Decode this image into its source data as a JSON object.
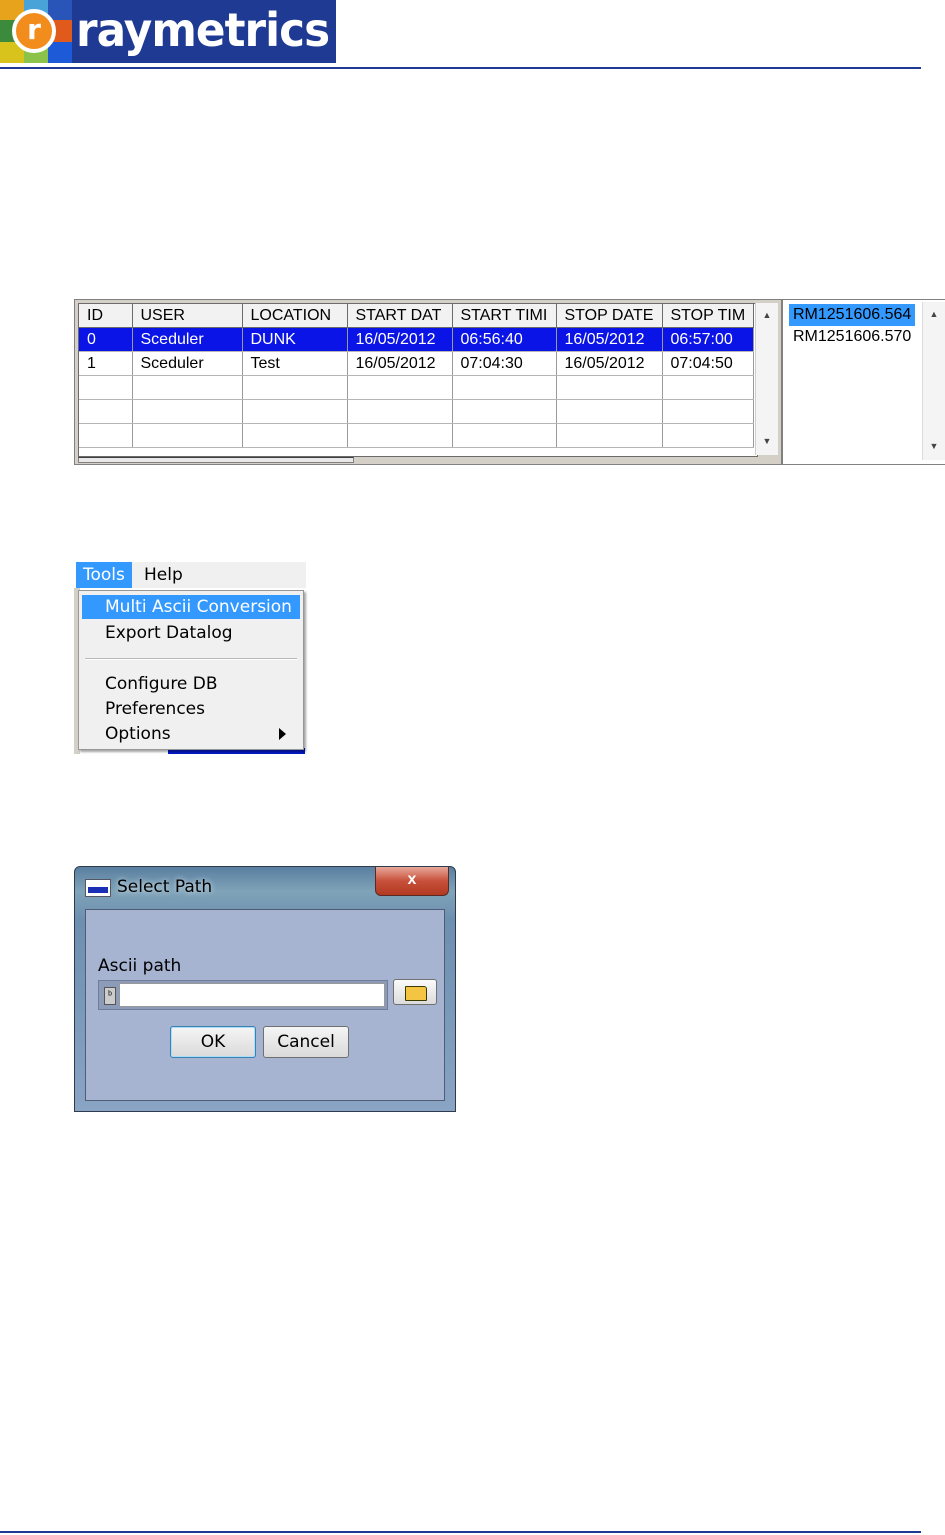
{
  "header": {
    "logo_text": "raymetrics",
    "logo_mark": "r",
    "brand_color": "#1f3a93"
  },
  "datalog_grid": {
    "columns": [
      "ID",
      "USER",
      "LOCATION",
      "START DAT",
      "START TIMI",
      "STOP DATE",
      "STOP TIM"
    ],
    "rows": [
      [
        "0",
        "Sceduler",
        "DUNK",
        "16/05/2012",
        "06:56:40",
        "16/05/2012",
        "06:57:00"
      ],
      [
        "1",
        "Sceduler",
        "Test",
        "16/05/2012",
        "07:04:30",
        "16/05/2012",
        "07:04:50"
      ]
    ],
    "selected_row": 0,
    "selection_color": "#0a14e6"
  },
  "file_list": {
    "items": [
      "RM1251606.564",
      "RM1251606.570"
    ],
    "selected_index": 0
  },
  "menu": {
    "bar": [
      "Tools",
      "Help"
    ],
    "active": "Tools",
    "items": [
      {
        "label": "Multi Ascii Conversion"
      },
      {
        "label": "Export Datalog"
      },
      {
        "label": "Configure DB"
      },
      {
        "label": "Preferences"
      },
      {
        "label": "Options",
        "submenu": true
      }
    ],
    "highlight_color": "#3399ff"
  },
  "select_path_dialog": {
    "title": "Select Path",
    "close_label": "x",
    "field_label": "Ascii path",
    "path_value": "",
    "ok_label": "OK",
    "cancel_label": "Cancel",
    "browse_icon": "folder-open-icon"
  }
}
